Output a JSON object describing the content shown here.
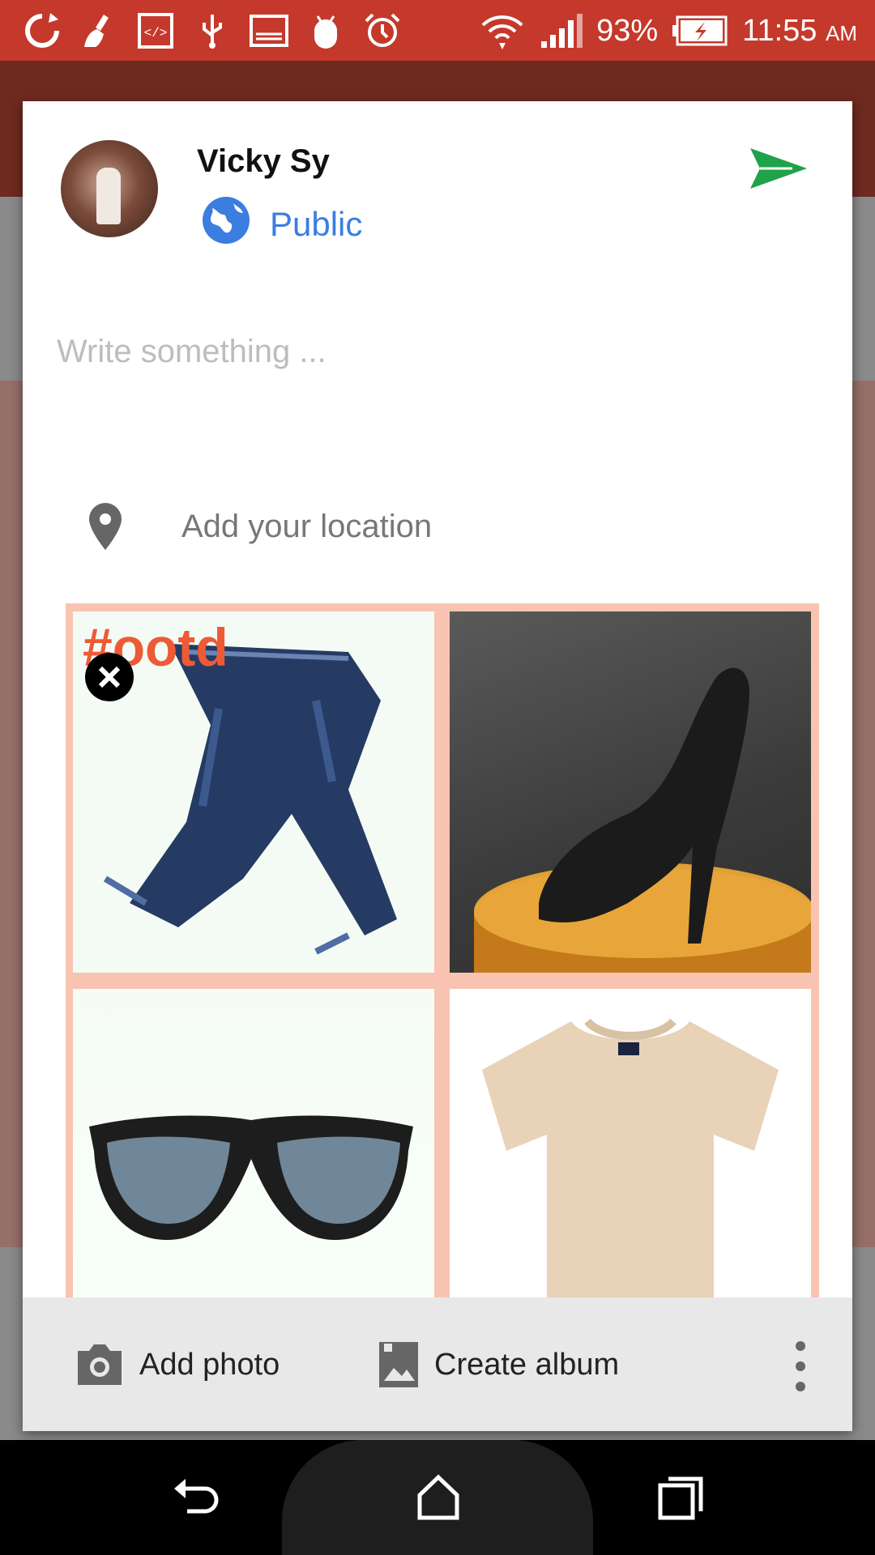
{
  "status_bar": {
    "battery": "93%",
    "time": "11:55",
    "ampm": "AM",
    "icons": [
      "sync-icon",
      "cleaner-icon",
      "code-icon",
      "usb-icon",
      "screenshot-icon",
      "android-icon",
      "alarm-icon",
      "wifi-icon",
      "signal-icon",
      "battery-charging-icon"
    ]
  },
  "dialog": {
    "user_name": "Vicky Sy",
    "privacy_label": "Public",
    "compose_placeholder": "Write something ...",
    "location_label": "Add your location",
    "watermark_text": "#ootd",
    "photos": [
      "jeans-photo",
      "high-heel-shoe-photo",
      "sunglasses-photo",
      "beige-tshirt-photo"
    ],
    "actions": {
      "add_photo": "Add photo",
      "create_album": "Create album"
    }
  },
  "colors": {
    "status_bar": "#c4392b",
    "accent_blue": "#3c7de0",
    "send_green": "#1fa24a",
    "grid_border": "#f8c4b1"
  }
}
